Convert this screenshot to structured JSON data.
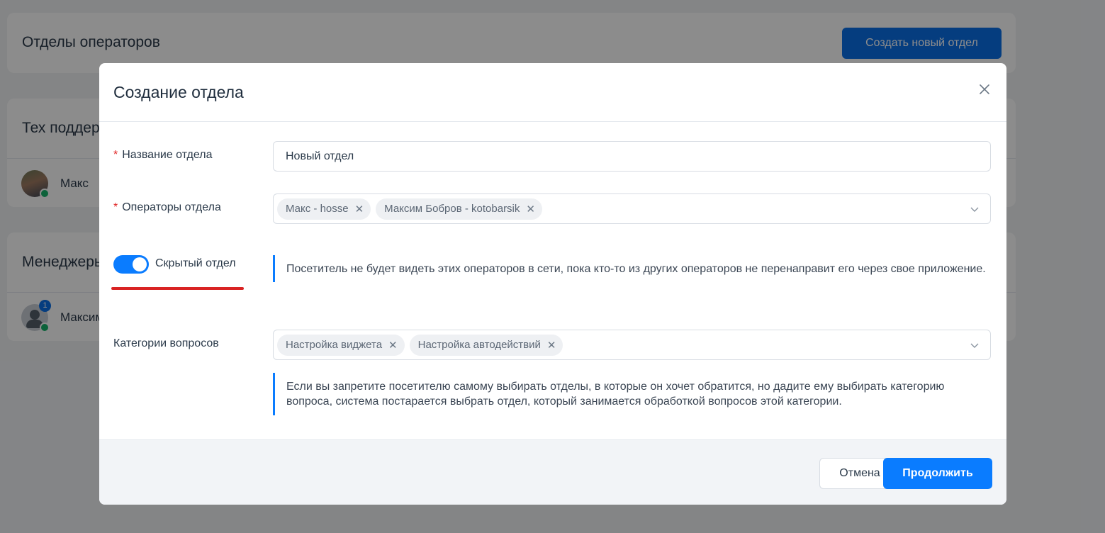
{
  "background": {
    "page_title": "Отделы операторов",
    "create_button": "Создать новый отдел",
    "departments": [
      {
        "name": "Тех поддер",
        "operator": "Макс",
        "online": true
      },
      {
        "name": "Менеджеры",
        "operator": "Максим",
        "online": true,
        "badge": "1"
      }
    ]
  },
  "modal": {
    "title": "Создание отдела",
    "close_icon": "close-icon",
    "name_field": {
      "label": "Название отдела",
      "required_mark": "*",
      "value": "Новый отдел"
    },
    "operators_field": {
      "label": "Операторы отдела",
      "required_mark": "*",
      "tags": [
        "Макс - hosse",
        "Максим Бобров - kotobarsik"
      ]
    },
    "hidden_toggle": {
      "label": "Скрытый отдел",
      "on": true,
      "hint": "Посетитель не будет видеть этих операторов в сети, пока кто-то из других операторов не перенаправит его через свое приложение."
    },
    "categories_field": {
      "label": "Категории вопросов",
      "tags": [
        "Настройка виджета",
        "Настройка автодействий"
      ],
      "hint": "Если вы запретите посетителю самому выбирать отделы, в которые он хочет обратится, но дадите ему выбирать категорию вопроса, система постарается выбрать отдел, который занимается обработкой вопросов этой категории."
    },
    "footer": {
      "cancel": "Отмена",
      "continue": "Продолжить"
    }
  },
  "colors": {
    "accent": "#0a7cff",
    "required": "#e02424",
    "highlight_underline": "#d92323",
    "online": "#17b26a"
  }
}
